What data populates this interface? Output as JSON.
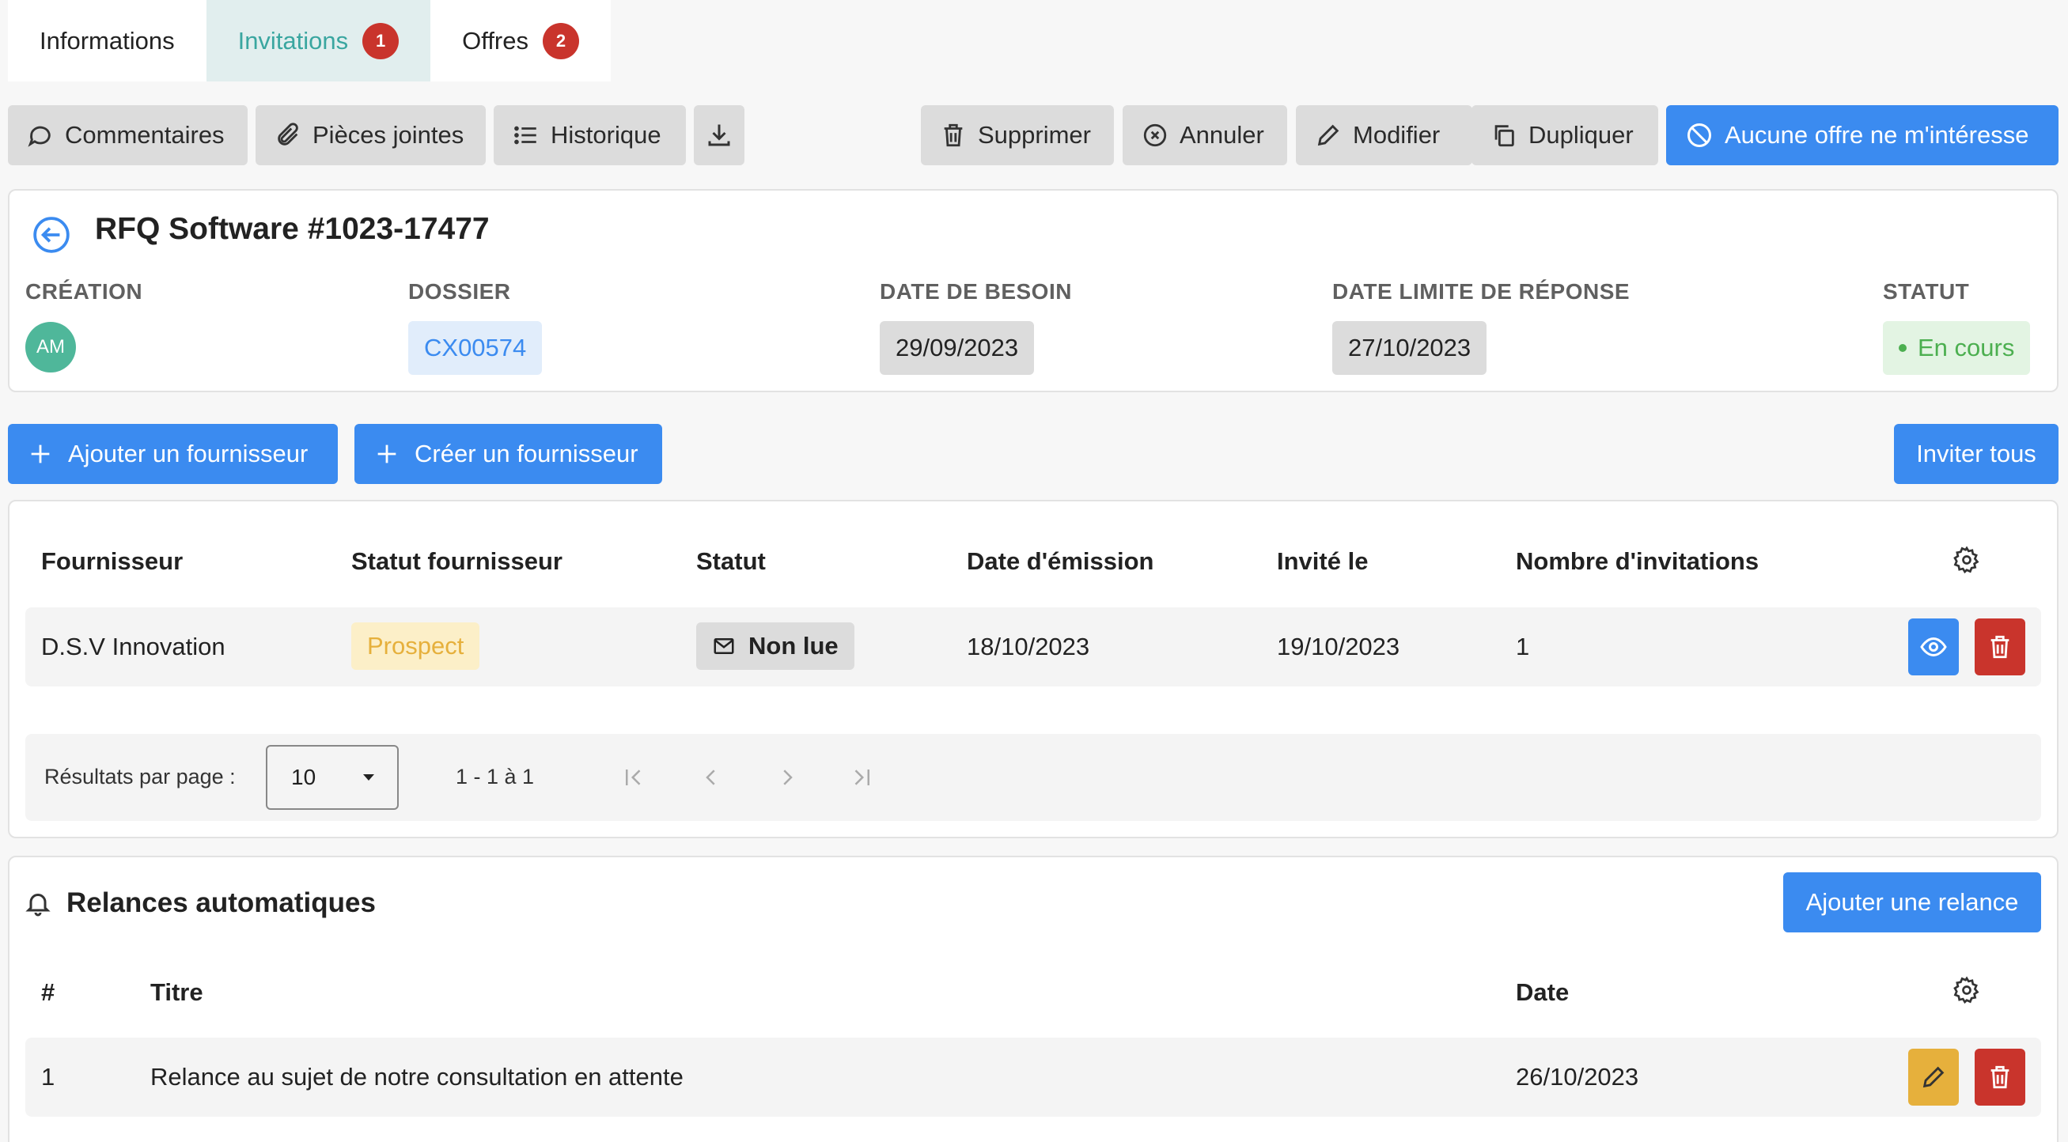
{
  "tabs": [
    {
      "label": "Informations"
    },
    {
      "label": "Invitations",
      "badge": "1"
    },
    {
      "label": "Offres",
      "badge": "2"
    }
  ],
  "toolbar": {
    "comments": "Commentaires",
    "attachments": "Pièces jointes",
    "history": "Historique",
    "delete": "Supprimer",
    "cancel": "Annuler",
    "edit": "Modifier",
    "duplicate": "Dupliquer",
    "no_offer": "Aucune offre ne m'intéresse"
  },
  "rfq": {
    "title": "RFQ Software #1023-17477",
    "creation_label": "CRÉATION",
    "creator_initials": "AM",
    "dossier_label": "DOSSIER",
    "dossier": "CX00574",
    "need_date_label": "DATE DE BESOIN",
    "need_date": "29/09/2023",
    "deadline_label": "DATE LIMITE DE RÉPONSE",
    "deadline": "27/10/2023",
    "status_label": "STATUT",
    "status": "En cours"
  },
  "actions": {
    "add_supplier": "Ajouter un fournisseur",
    "create_supplier": "Créer un fournisseur",
    "invite_all": "Inviter tous"
  },
  "suppliers_table": {
    "headers": [
      "Fournisseur",
      "Statut fournisseur",
      "Statut",
      "Date d'émission",
      "Invité le",
      "Nombre d'invitations"
    ],
    "rows": [
      {
        "supplier": "D.S.V Innovation",
        "supplier_status": "Prospect",
        "status": "Non lue",
        "issue_date": "18/10/2023",
        "invited_on": "19/10/2023",
        "invitations": "1"
      }
    ]
  },
  "pagination": {
    "per_page_label": "Résultats par page :",
    "per_page": "10",
    "range": "1 - 1 à 1"
  },
  "reminders": {
    "title": "Relances automatiques",
    "add_button": "Ajouter une relance",
    "headers": [
      "#",
      "Titre",
      "Date"
    ],
    "rows": [
      {
        "num": "1",
        "title": "Relance au sujet de notre consultation en attente",
        "date": "26/10/2023"
      }
    ]
  },
  "colors": {
    "primary": "#3b8bf0",
    "danger": "#c9342c",
    "warning": "#e6b03c",
    "teal": "#3aa6a0",
    "success": "#4caf50"
  }
}
